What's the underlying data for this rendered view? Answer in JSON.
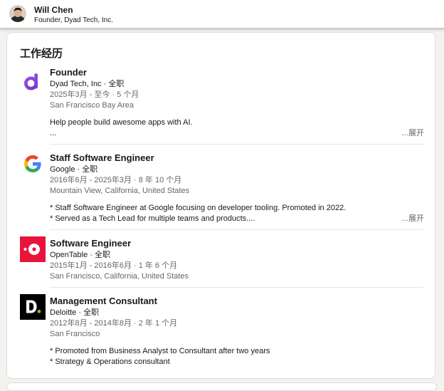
{
  "profile": {
    "name": "Will Chen",
    "headline": "Founder, Dyad Tech, Inc."
  },
  "section": {
    "title": "工作经历",
    "expand_label": "...展开"
  },
  "experiences": [
    {
      "title": "Founder",
      "company": "Dyad Tech, Inc · 全职",
      "dates": "2025年3月 - 至今 · 5 个月",
      "location": "San Francisco Bay Area",
      "desc1": "Help people build awesome apps with AI.",
      "desc2": "...",
      "logo": "dyad-logo-icon",
      "color": "#7b3fd9"
    },
    {
      "title": "Staff Software Engineer",
      "company": "Google · 全职",
      "dates": "2016年6月 - 2025年3月 · 8 年 10 个月",
      "location": "Mountain View, California, United States",
      "desc1": "* Staff Software Engineer at Google focusing on developer tooling. Promoted in 2022.",
      "desc2": "* Served as a Tech Lead for multiple teams and products....",
      "logo": "google-logo-icon",
      "color": "#4285f4"
    },
    {
      "title": "Software Engineer",
      "company": "OpenTable · 全职",
      "dates": "2015年1月 - 2016年6月 · 1 年 6 个月",
      "location": "San Francisco, California, United States",
      "logo": "opentable-logo-icon",
      "color": "#e8143c"
    },
    {
      "title": "Management Consultant",
      "company": "Deloitte · 全职",
      "dates": "2012年8月 - 2014年8月 · 2 年 1 个月",
      "location": "San Francisco",
      "desc1": "* Promoted from Business Analyst to Consultant after two years",
      "desc2": "* Strategy & Operations consultant",
      "logo": "deloitte-logo-icon",
      "color": "#000000"
    }
  ]
}
